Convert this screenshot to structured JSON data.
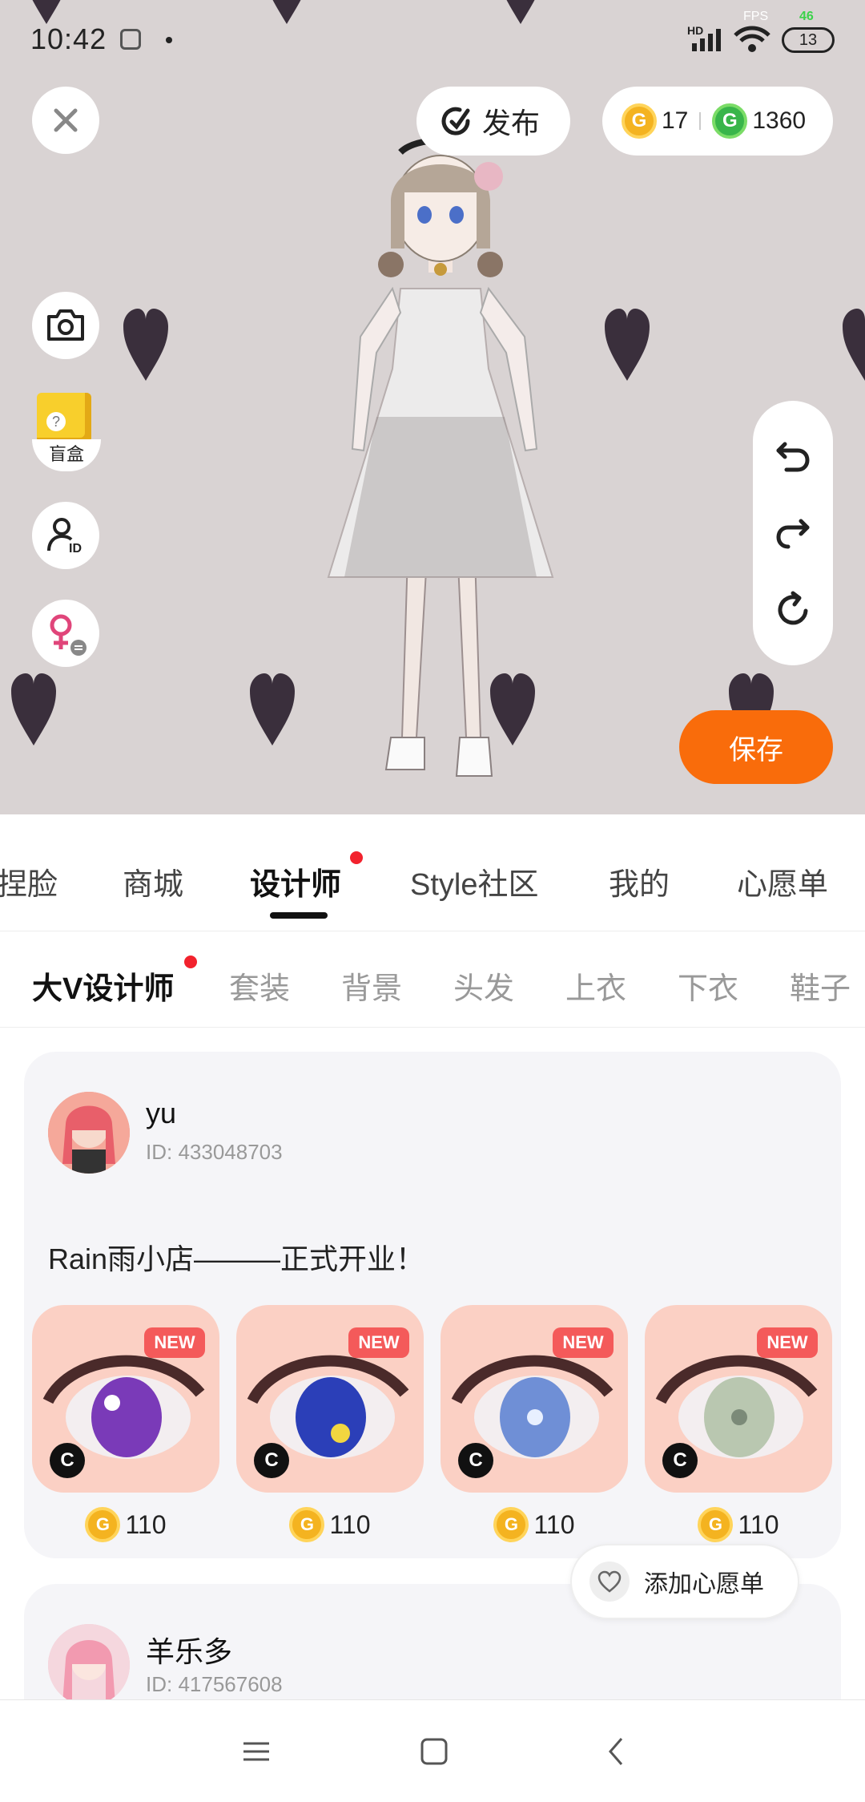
{
  "status_bar": {
    "time": "10:42",
    "hd_label": "HD",
    "fps_label": "FPS",
    "fps_value": "46",
    "battery": "13"
  },
  "header": {
    "publish_label": "发布",
    "gold_coins": "17",
    "green_coins": "1360"
  },
  "side_tools": {
    "blind_box_label": "盲盒"
  },
  "save_label": "保存",
  "main_tabs": [
    {
      "label": "捏脸"
    },
    {
      "label": "商城"
    },
    {
      "label": "设计师",
      "active": true,
      "dot": true
    },
    {
      "label": "Style社区"
    },
    {
      "label": "我的"
    },
    {
      "label": "心愿单"
    }
  ],
  "sub_tabs": [
    {
      "label": "大V设计师",
      "active": true,
      "dot": true
    },
    {
      "label": "套装"
    },
    {
      "label": "背景"
    },
    {
      "label": "头发"
    },
    {
      "label": "上衣"
    },
    {
      "label": "下衣"
    },
    {
      "label": "鞋子"
    }
  ],
  "posts": [
    {
      "user_name": "yu",
      "user_id": "ID: 433048703",
      "text": "Rain雨小店———正式开业！",
      "items": [
        {
          "badge": "NEW",
          "creator_mark": "C",
          "price": "110",
          "iris": "#7a3ab8"
        },
        {
          "badge": "NEW",
          "creator_mark": "C",
          "price": "110",
          "iris": "#2b3fb8"
        },
        {
          "badge": "NEW",
          "creator_mark": "C",
          "price": "110",
          "iris": "#6f8fd6"
        },
        {
          "badge": "NEW",
          "creator_mark": "C",
          "price": "110",
          "iris": "#b9c7b0"
        }
      ]
    },
    {
      "user_name": "羊乐多",
      "user_id": "ID: 417567608"
    }
  ],
  "wishlist_label": "添加心愿单",
  "colors": {
    "accent_orange": "#f96c0b",
    "coin_gold": "#f4b320",
    "coin_green": "#39b54a",
    "badge_red": "#f45a5a",
    "scene_bg": "#d9d3d3"
  },
  "icons": {
    "close": "close-icon",
    "publish": "publish-icon",
    "camera": "camera-icon",
    "blind_box": "blind-box-icon",
    "avatar_id": "avatar-id-icon",
    "gender_switch": "gender-switch-icon",
    "undo": "undo-icon",
    "redo": "redo-icon",
    "reset": "reset-icon",
    "heart": "heart-icon",
    "nav_menu": "menu-icon",
    "nav_home": "home-icon",
    "nav_back": "back-icon"
  }
}
